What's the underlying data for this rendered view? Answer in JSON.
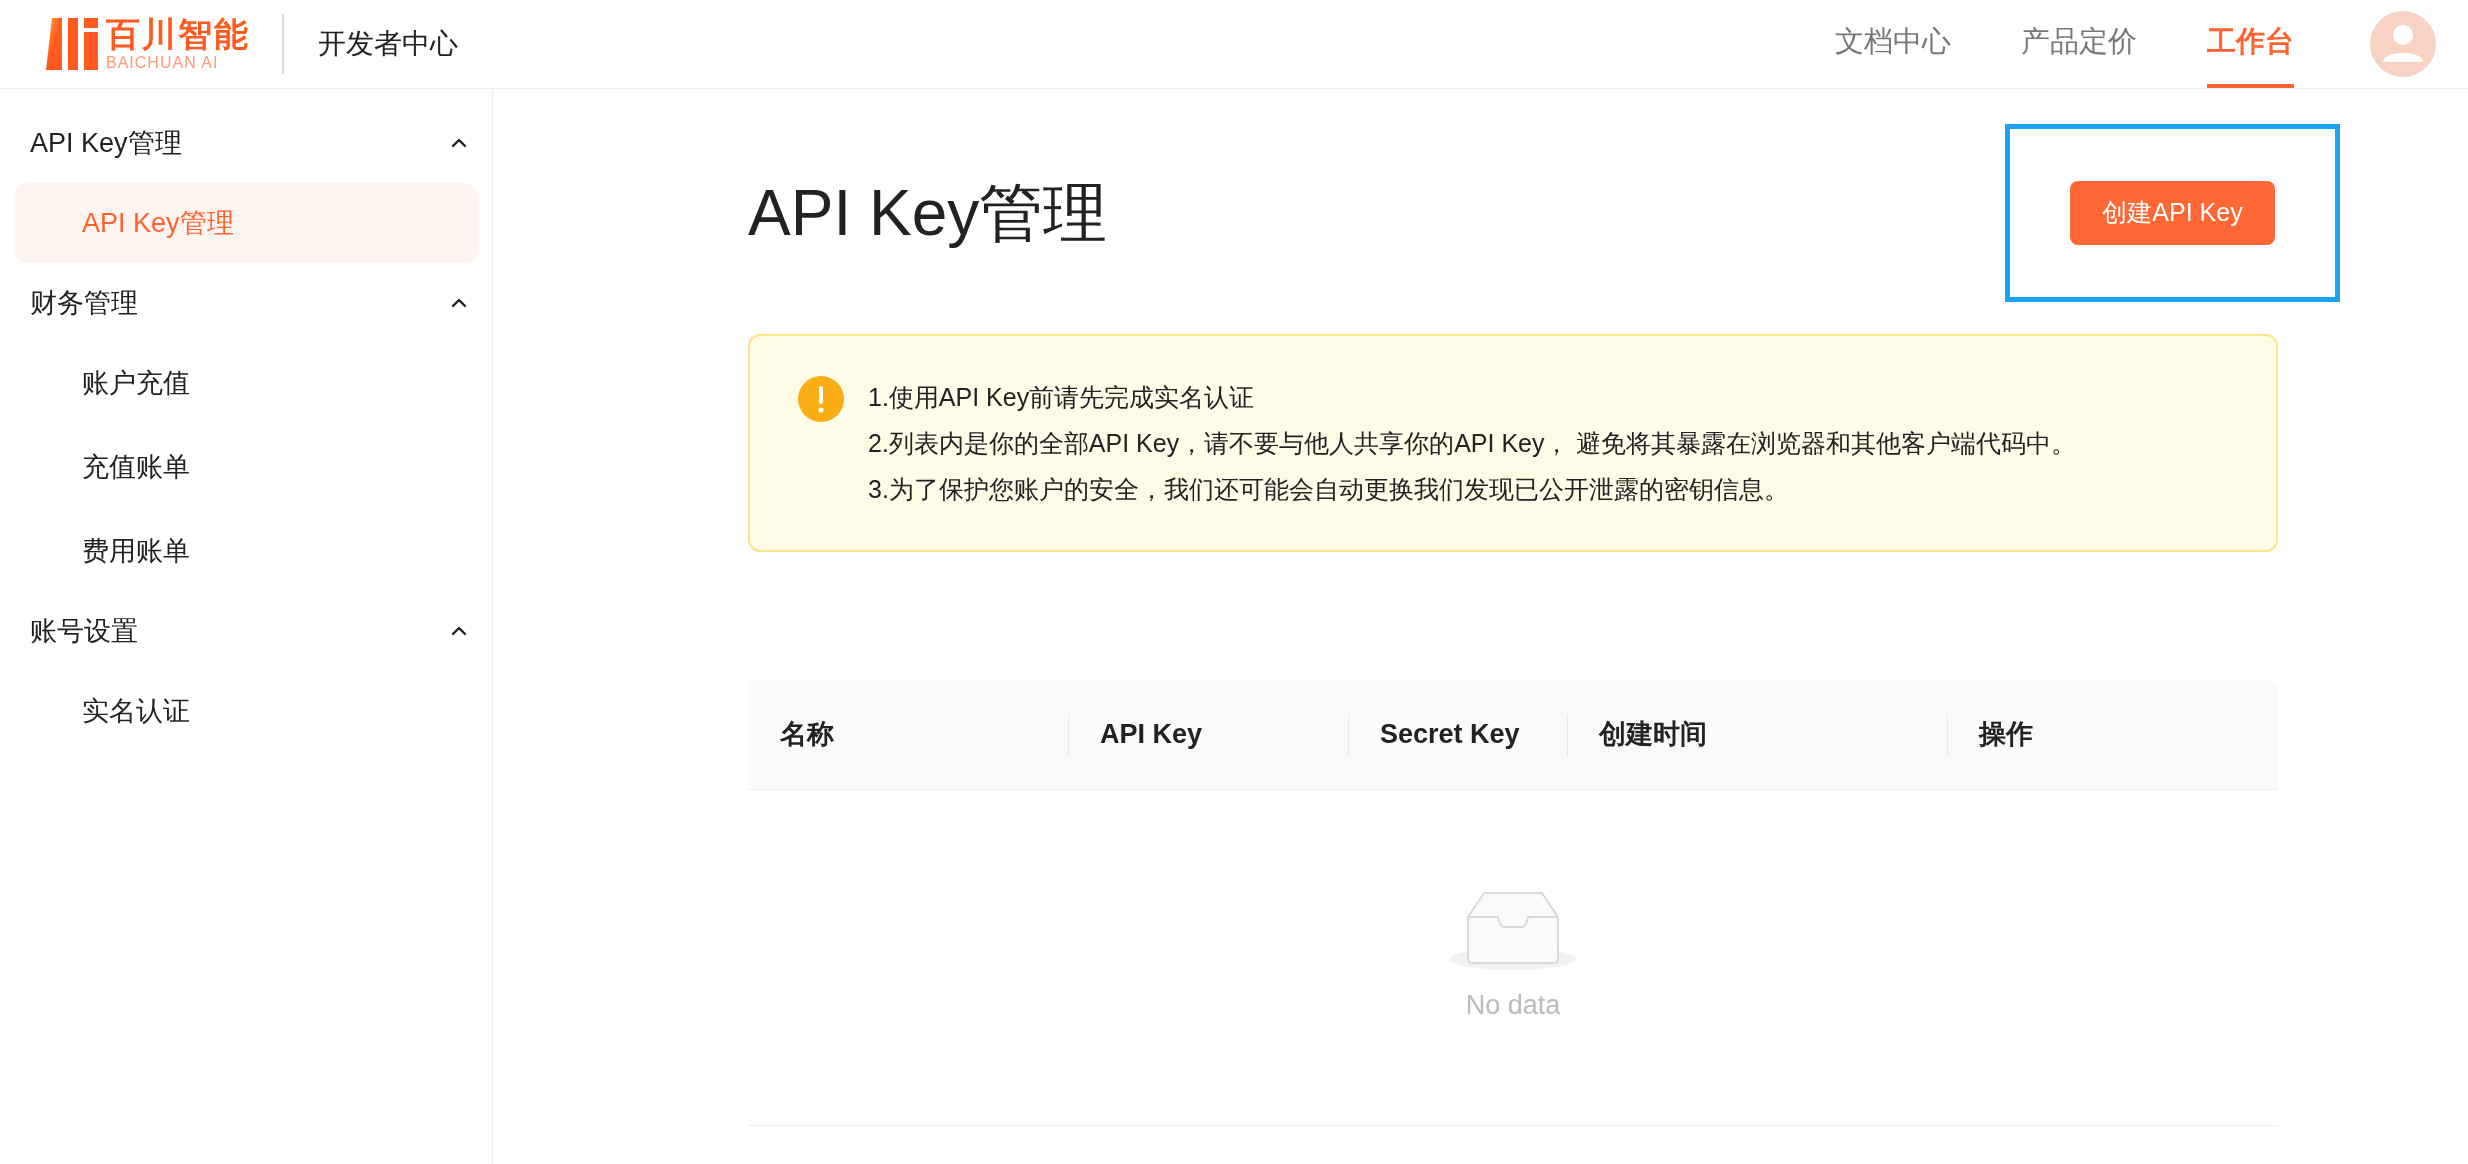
{
  "header": {
    "logo": {
      "name": "百川智能",
      "subtitle": "BAICHUAN AI"
    },
    "section": "开发者中心",
    "nav": [
      {
        "label": "文档中心",
        "selected": false
      },
      {
        "label": "产品定价",
        "selected": false
      },
      {
        "label": "工作台",
        "selected": true
      }
    ]
  },
  "sidebar": {
    "groups": [
      {
        "label": "API Key管理",
        "expanded": true,
        "items": [
          {
            "label": "API Key管理",
            "selected": true
          }
        ]
      },
      {
        "label": "财务管理",
        "expanded": true,
        "items": [
          {
            "label": "账户充值",
            "selected": false
          },
          {
            "label": "充值账单",
            "selected": false
          },
          {
            "label": "费用账单",
            "selected": false
          }
        ]
      },
      {
        "label": "账号设置",
        "expanded": true,
        "items": [
          {
            "label": "实名认证",
            "selected": false
          }
        ]
      }
    ]
  },
  "page": {
    "title": "API Key管理",
    "create_button": "创建API Key",
    "notice": [
      "1.使用API Key前请先完成实名认证",
      "2.列表内是你的全部API Key，请不要与他人共享你的API Key， 避免将其暴露在浏览器和其他客户端代码中。",
      "3.为了保护您账户的安全，我们还可能会自动更换我们发现已公开泄露的密钥信息。"
    ],
    "table": {
      "columns": [
        "名称",
        "API Key",
        "Secret Key",
        "创建时间",
        "操作"
      ],
      "empty_text": "No data"
    }
  }
}
